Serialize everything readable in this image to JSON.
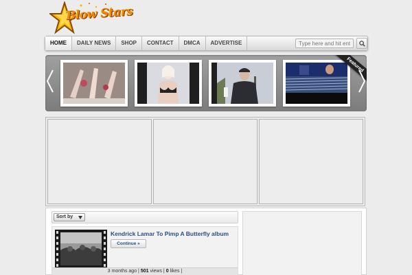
{
  "logo": {
    "text": "Blow Stars"
  },
  "nav": {
    "items": [
      {
        "label": "HOME",
        "active": true
      },
      {
        "label": "DAILY NEWS",
        "active": false
      },
      {
        "label": "SHOP",
        "active": false
      },
      {
        "label": "CONTACT",
        "active": false
      },
      {
        "label": "DMCA",
        "active": false
      },
      {
        "label": "ADVERTISE",
        "active": false
      }
    ],
    "search_placeholder": "Type here and hit enter",
    "search_icon": "search-icon"
  },
  "slider": {
    "badge": "Featured",
    "icons": {
      "prev": "chevron-left-icon",
      "next": "chevron-right-icon"
    }
  },
  "content": {
    "sort_label": "Sort by",
    "post": {
      "title": "Kendrick Lamar To Pimp A Butterfly album",
      "continue_label": "Continue »",
      "age": "3 months ago",
      "views": "501",
      "views_label": "views",
      "likes": "0",
      "likes_label": "likes"
    }
  },
  "colors": {
    "accent": "#2a4e86",
    "logo": "#f08a00",
    "slider_bg": "#8e8e8e"
  }
}
